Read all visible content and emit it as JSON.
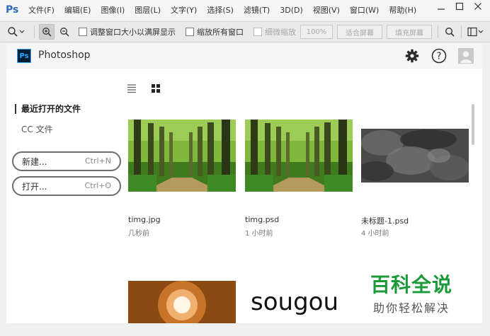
{
  "menubar": {
    "logo": "Ps",
    "items": [
      "文件(F)",
      "编辑(E)",
      "图像(I)",
      "图层(L)",
      "文字(Y)",
      "选择(S)",
      "滤镜(T)",
      "3D(D)",
      "视图(V)",
      "窗口(W)",
      "帮助(H)"
    ],
    "window_controls": [
      "minimize",
      "restore",
      "close"
    ]
  },
  "options_bar": {
    "resize_windows_label": "调整窗口大小以满屏显示",
    "zoom_all_windows_label": "缩放所有窗口",
    "scrubby_zoom_label": "细微缩放",
    "zoom_percent": "100%",
    "fit_screen": "适合屏幕",
    "fill_screen": "填充屏幕"
  },
  "header": {
    "app_icon_text": "Ps",
    "app_title": "Photoshop"
  },
  "sidebar": {
    "recent_title": "最近打开的文件",
    "cc_files": "CC 文件",
    "new_button": {
      "label": "新建...",
      "shortcut": "Ctrl+N"
    },
    "open_button": {
      "label": "打开...",
      "shortcut": "Ctrl+O"
    }
  },
  "recent_files": [
    {
      "name": "timg.jpg",
      "time": "几秒前",
      "thumb": "forest"
    },
    {
      "name": "timg.psd",
      "time": "1 小时前",
      "thumb": "forest"
    },
    {
      "name": "未标题-1.psd",
      "time": "4 小时前",
      "thumb": "clouds"
    },
    {
      "name": "",
      "time": "",
      "thumb": "burst"
    },
    {
      "name": "",
      "time": "",
      "thumb": "sougou"
    }
  ],
  "thumb_text": {
    "sougou": "sougou"
  },
  "watermark": {
    "title": "百科全说",
    "subtitle": "助你轻松解决"
  },
  "colors": {
    "accent": "#31a8ff",
    "watermark_green": "#1c9a3a",
    "forest": "#3f7a1c",
    "clouds": "#5a5a5a"
  }
}
